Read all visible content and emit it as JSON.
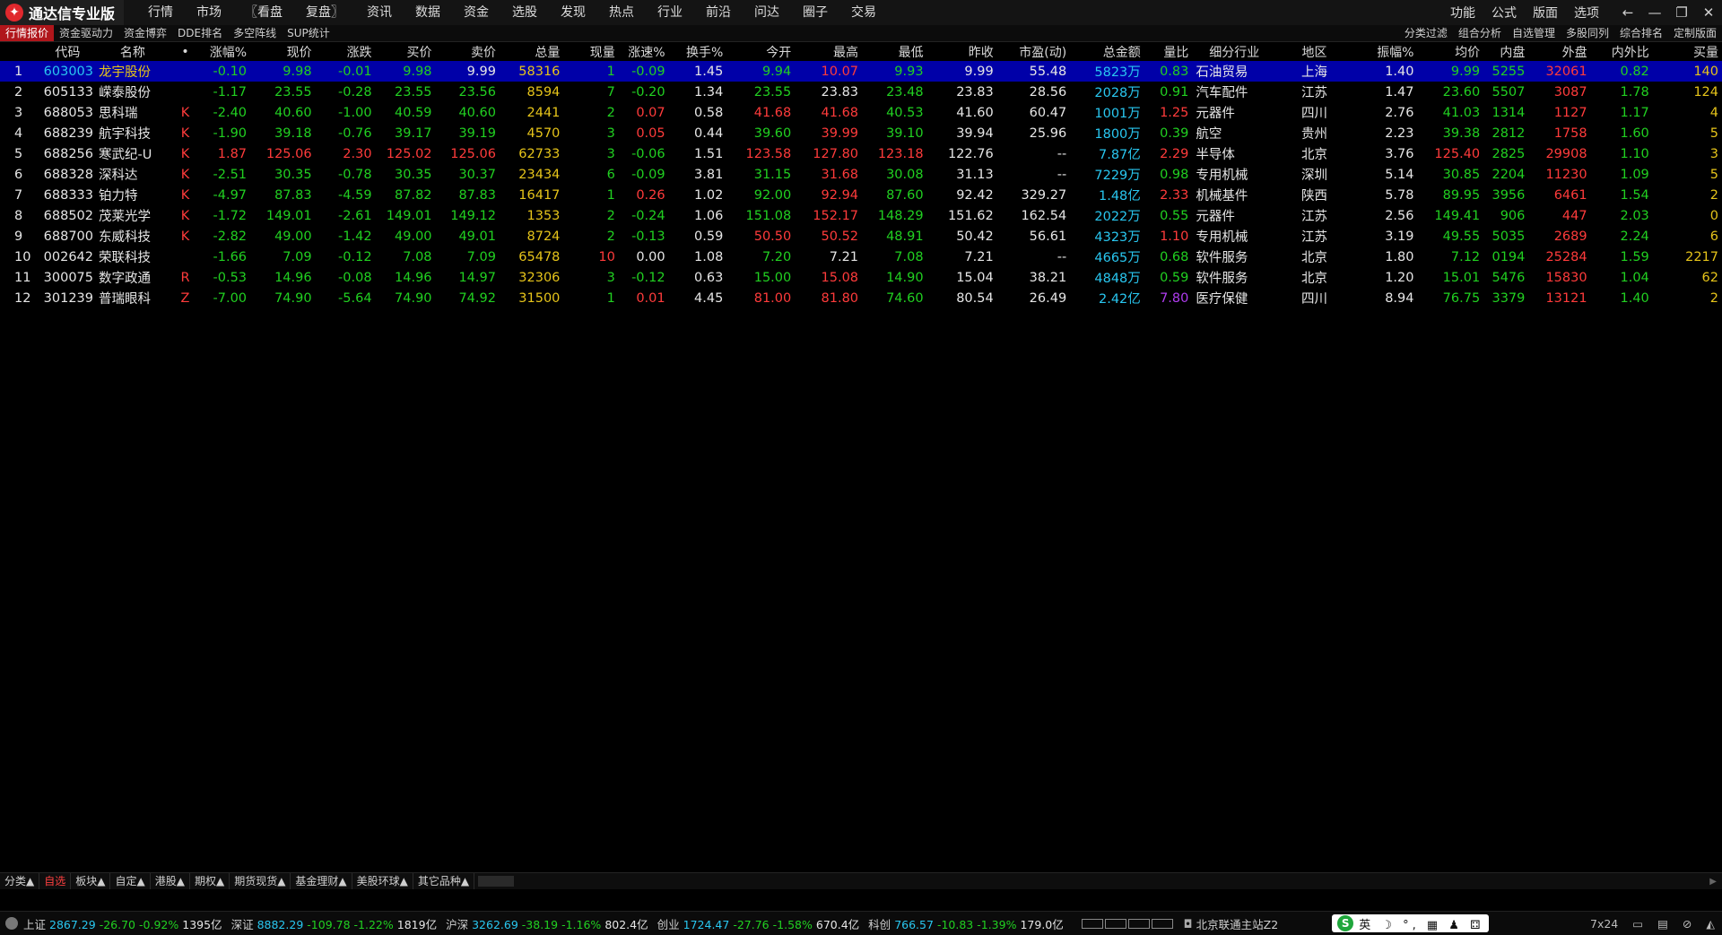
{
  "app": {
    "title": "通达信专业版",
    "menu": [
      "行情",
      "市场",
      "〖看盘",
      "复盘〗",
      "资讯",
      "数据",
      "资金",
      "选股",
      "发现",
      "热点",
      "行业",
      "前沿",
      "问达",
      "圈子",
      "交易"
    ],
    "right_menu": [
      "功能",
      "公式",
      "版面",
      "选项"
    ]
  },
  "tabs": {
    "left": [
      "行情报价",
      "资金驱动力",
      "资金博弈",
      "DDE排名",
      "多空阵线",
      "SUP统计"
    ],
    "right": [
      "分类过滤",
      "组合分析",
      "自选管理",
      "多股同列",
      "综合排名",
      "定制版面"
    ]
  },
  "table": {
    "headers": [
      "",
      "代码",
      "名称",
      "•",
      "涨幅%",
      "现价",
      "涨跌",
      "买价",
      "卖价",
      "总量",
      "现量",
      "涨速%",
      "换手%",
      "今开",
      "最高",
      "最低",
      "昨收",
      "市盈(动)",
      "总金额",
      "量比",
      "细分行业",
      "地区",
      "振幅%",
      "均价",
      "内盘",
      "外盘",
      "内外比",
      "买量"
    ],
    "rows": [
      [
        "1",
        "603003",
        "龙宇股份",
        "",
        "-0.10",
        "9.98",
        "-0.01",
        "9.98",
        "9.99",
        "58316",
        "1",
        "-0.09",
        "1.45",
        "9.94",
        "10.07",
        "9.93",
        "9.99",
        "55.48",
        "5823万",
        "0.83",
        "石油贸易",
        "上海",
        "1.40",
        "9.99",
        "5255",
        "32061",
        "0.82",
        "140"
      ],
      [
        "2",
        "605133",
        "嵘泰股份",
        "",
        "-1.17",
        "23.55",
        "-0.28",
        "23.55",
        "23.56",
        "8594",
        "7",
        "-0.20",
        "1.34",
        "23.55",
        "23.83",
        "23.48",
        "23.83",
        "28.56",
        "2028万",
        "0.91",
        "汽车配件",
        "江苏",
        "1.47",
        "23.60",
        "5507",
        "3087",
        "1.78",
        "124"
      ],
      [
        "3",
        "688053",
        "思科瑞",
        "K",
        "-2.40",
        "40.60",
        "-1.00",
        "40.59",
        "40.60",
        "2441",
        "2",
        "0.07",
        "0.58",
        "41.68",
        "41.68",
        "40.53",
        "41.60",
        "60.47",
        "1001万",
        "1.25",
        "元器件",
        "四川",
        "2.76",
        "41.03",
        "1314",
        "1127",
        "1.17",
        "4"
      ],
      [
        "4",
        "688239",
        "航宇科技",
        "K",
        "-1.90",
        "39.18",
        "-0.76",
        "39.17",
        "39.19",
        "4570",
        "3",
        "0.05",
        "0.44",
        "39.60",
        "39.99",
        "39.10",
        "39.94",
        "25.96",
        "1800万",
        "0.39",
        "航空",
        "贵州",
        "2.23",
        "39.38",
        "2812",
        "1758",
        "1.60",
        "5"
      ],
      [
        "5",
        "688256",
        "寒武纪-U",
        "K",
        "1.87",
        "125.06",
        "2.30",
        "125.02",
        "125.06",
        "62733",
        "3",
        "-0.06",
        "1.51",
        "123.58",
        "127.80",
        "123.18",
        "122.76",
        "--",
        "7.87亿",
        "2.29",
        "半导体",
        "北京",
        "3.76",
        "125.40",
        "2825",
        "29908",
        "1.10",
        "3"
      ],
      [
        "6",
        "688328",
        "深科达",
        "K",
        "-2.51",
        "30.35",
        "-0.78",
        "30.35",
        "30.37",
        "23434",
        "6",
        "-0.09",
        "3.81",
        "31.15",
        "31.68",
        "30.08",
        "31.13",
        "--",
        "7229万",
        "0.98",
        "专用机械",
        "深圳",
        "5.14",
        "30.85",
        "2204",
        "11230",
        "1.09",
        "5"
      ],
      [
        "7",
        "688333",
        "铂力特",
        "K",
        "-4.97",
        "87.83",
        "-4.59",
        "87.82",
        "87.83",
        "16417",
        "1",
        "0.26",
        "1.02",
        "92.00",
        "92.94",
        "87.60",
        "92.42",
        "329.27",
        "1.48亿",
        "2.33",
        "机械基件",
        "陕西",
        "5.78",
        "89.95",
        "3956",
        "6461",
        "1.54",
        "2"
      ],
      [
        "8",
        "688502",
        "茂莱光学",
        "K",
        "-1.72",
        "149.01",
        "-2.61",
        "149.01",
        "149.12",
        "1353",
        "2",
        "-0.24",
        "1.06",
        "151.08",
        "152.17",
        "148.29",
        "151.62",
        "162.54",
        "2022万",
        "0.55",
        "元器件",
        "江苏",
        "2.56",
        "149.41",
        "906",
        "447",
        "2.03",
        "0"
      ],
      [
        "9",
        "688700",
        "东威科技",
        "K",
        "-2.82",
        "49.00",
        "-1.42",
        "49.00",
        "49.01",
        "8724",
        "2",
        "-0.13",
        "0.59",
        "50.50",
        "50.52",
        "48.91",
        "50.42",
        "56.61",
        "4323万",
        "1.10",
        "专用机械",
        "江苏",
        "3.19",
        "49.55",
        "5035",
        "2689",
        "2.24",
        "6"
      ],
      [
        "10",
        "002642",
        "荣联科技",
        "",
        "-1.66",
        "7.09",
        "-0.12",
        "7.08",
        "7.09",
        "65478",
        "10",
        "0.00",
        "1.08",
        "7.20",
        "7.21",
        "7.08",
        "7.21",
        "--",
        "4665万",
        "0.68",
        "软件服务",
        "北京",
        "1.80",
        "7.12",
        "0194",
        "25284",
        "1.59",
        "2217"
      ],
      [
        "11",
        "300075",
        "数字政通",
        "R",
        "-0.53",
        "14.96",
        "-0.08",
        "14.96",
        "14.97",
        "32306",
        "3",
        "-0.12",
        "0.63",
        "15.00",
        "15.08",
        "14.90",
        "15.04",
        "38.21",
        "4848万",
        "0.59",
        "软件服务",
        "北京",
        "1.20",
        "15.01",
        "5476",
        "15830",
        "1.04",
        "62"
      ],
      [
        "12",
        "301239",
        "普瑞眼科",
        "Z",
        "-7.00",
        "74.90",
        "-5.64",
        "74.90",
        "74.92",
        "31500",
        "1",
        "0.01",
        "4.45",
        "81.00",
        "81.80",
        "74.60",
        "80.54",
        "26.49",
        "2.42亿",
        "7.80",
        "医疗保健",
        "四川",
        "8.94",
        "76.75",
        "3379",
        "13121",
        "1.40",
        "2"
      ]
    ],
    "row_colors": [
      [
        "white",
        "cyan",
        "yellow",
        "red",
        "green",
        "green",
        "green",
        "green",
        "white",
        "yellow",
        "green",
        "green",
        "white",
        "green",
        "red",
        "green",
        "white",
        "white",
        "cyan",
        "green",
        "white",
        "white",
        "white",
        "green",
        "green",
        "red",
        "green",
        "yellow"
      ],
      [
        "white",
        "white",
        "white",
        "red",
        "green",
        "green",
        "green",
        "green",
        "green",
        "yellow",
        "green",
        "green",
        "white",
        "green",
        "white",
        "green",
        "white",
        "white",
        "cyan",
        "green",
        "white",
        "white",
        "white",
        "green",
        "green",
        "red",
        "green",
        "yellow"
      ],
      [
        "white",
        "white",
        "white",
        "red",
        "green",
        "green",
        "green",
        "green",
        "green",
        "yellow",
        "green",
        "red",
        "white",
        "red",
        "red",
        "green",
        "white",
        "white",
        "cyan",
        "red",
        "white",
        "white",
        "white",
        "green",
        "green",
        "red",
        "green",
        "yellow"
      ],
      [
        "white",
        "white",
        "white",
        "red",
        "green",
        "green",
        "green",
        "green",
        "green",
        "yellow",
        "green",
        "red",
        "white",
        "green",
        "red",
        "green",
        "white",
        "white",
        "cyan",
        "green",
        "white",
        "white",
        "white",
        "green",
        "green",
        "red",
        "green",
        "yellow"
      ],
      [
        "white",
        "white",
        "white",
        "red",
        "red",
        "red",
        "red",
        "red",
        "red",
        "yellow",
        "green",
        "green",
        "white",
        "red",
        "red",
        "red",
        "white",
        "white",
        "cyan",
        "red",
        "white",
        "white",
        "white",
        "red",
        "green",
        "red",
        "green",
        "yellow"
      ],
      [
        "white",
        "white",
        "white",
        "red",
        "green",
        "green",
        "green",
        "green",
        "green",
        "yellow",
        "green",
        "green",
        "white",
        "green",
        "red",
        "green",
        "white",
        "white",
        "cyan",
        "green",
        "white",
        "white",
        "white",
        "green",
        "green",
        "red",
        "green",
        "yellow"
      ],
      [
        "white",
        "white",
        "white",
        "red",
        "green",
        "green",
        "green",
        "green",
        "green",
        "yellow",
        "green",
        "red",
        "white",
        "green",
        "red",
        "green",
        "white",
        "white",
        "cyan",
        "red",
        "white",
        "white",
        "white",
        "green",
        "green",
        "red",
        "green",
        "yellow"
      ],
      [
        "white",
        "white",
        "white",
        "red",
        "green",
        "green",
        "green",
        "green",
        "green",
        "yellow",
        "green",
        "green",
        "white",
        "green",
        "red",
        "green",
        "white",
        "white",
        "cyan",
        "green",
        "white",
        "white",
        "white",
        "green",
        "green",
        "red",
        "green",
        "yellow"
      ],
      [
        "white",
        "white",
        "white",
        "red",
        "green",
        "green",
        "green",
        "green",
        "green",
        "yellow",
        "green",
        "green",
        "white",
        "red",
        "red",
        "green",
        "white",
        "white",
        "cyan",
        "red",
        "white",
        "white",
        "white",
        "green",
        "green",
        "red",
        "green",
        "yellow"
      ],
      [
        "white",
        "white",
        "white",
        "red",
        "green",
        "green",
        "green",
        "green",
        "green",
        "yellow",
        "red",
        "white",
        "white",
        "green",
        "white",
        "green",
        "white",
        "white",
        "cyan",
        "green",
        "white",
        "white",
        "white",
        "green",
        "green",
        "red",
        "green",
        "yellow"
      ],
      [
        "white",
        "white",
        "white",
        "red",
        "green",
        "green",
        "green",
        "green",
        "green",
        "yellow",
        "green",
        "green",
        "white",
        "green",
        "red",
        "green",
        "white",
        "white",
        "cyan",
        "green",
        "white",
        "white",
        "white",
        "green",
        "green",
        "red",
        "green",
        "yellow"
      ],
      [
        "white",
        "white",
        "white",
        "red",
        "green",
        "green",
        "green",
        "green",
        "green",
        "yellow",
        "green",
        "red",
        "white",
        "red",
        "red",
        "green",
        "white",
        "white",
        "cyan",
        "purple",
        "white",
        "white",
        "white",
        "green",
        "green",
        "red",
        "green",
        "yellow"
      ]
    ]
  },
  "bottom_tabs": [
    "分类▲",
    "自选",
    "板块▲",
    "自定▲",
    "港股▲",
    "期权▲",
    "期货现货▲",
    "基金理财▲",
    "美股环球▲",
    "其它品种▲"
  ],
  "status": {
    "indices": [
      {
        "name": "上证",
        "value": "2867.29",
        "change": "-26.70",
        "pct": "-0.92%",
        "amount": "1395亿"
      },
      {
        "name": "深证",
        "value": "8882.29",
        "change": "-109.78",
        "pct": "-1.22%",
        "amount": "1819亿"
      },
      {
        "name": "沪深",
        "value": "3262.69",
        "change": "-38.19",
        "pct": "-1.16%",
        "amount": "802.4亿"
      },
      {
        "name": "创业",
        "value": "1724.47",
        "change": "-27.76",
        "pct": "-1.58%",
        "amount": "670.4亿"
      },
      {
        "name": "科创",
        "value": "766.57",
        "change": "-10.83",
        "pct": "-1.39%",
        "amount": "179.0亿"
      }
    ],
    "server": "北京联通主站Z2",
    "ime_text": "英 ☽ °, ▦ ♟ ⚃",
    "right_text": "7x24"
  },
  "colors": {
    "red": "#ff3b3b",
    "green": "#21d021",
    "yellow": "#e6c41a",
    "cyan": "#29c7f0",
    "purple": "#b03cf0",
    "select_row": "#0000a8",
    "active_tab": "#b0161b"
  }
}
